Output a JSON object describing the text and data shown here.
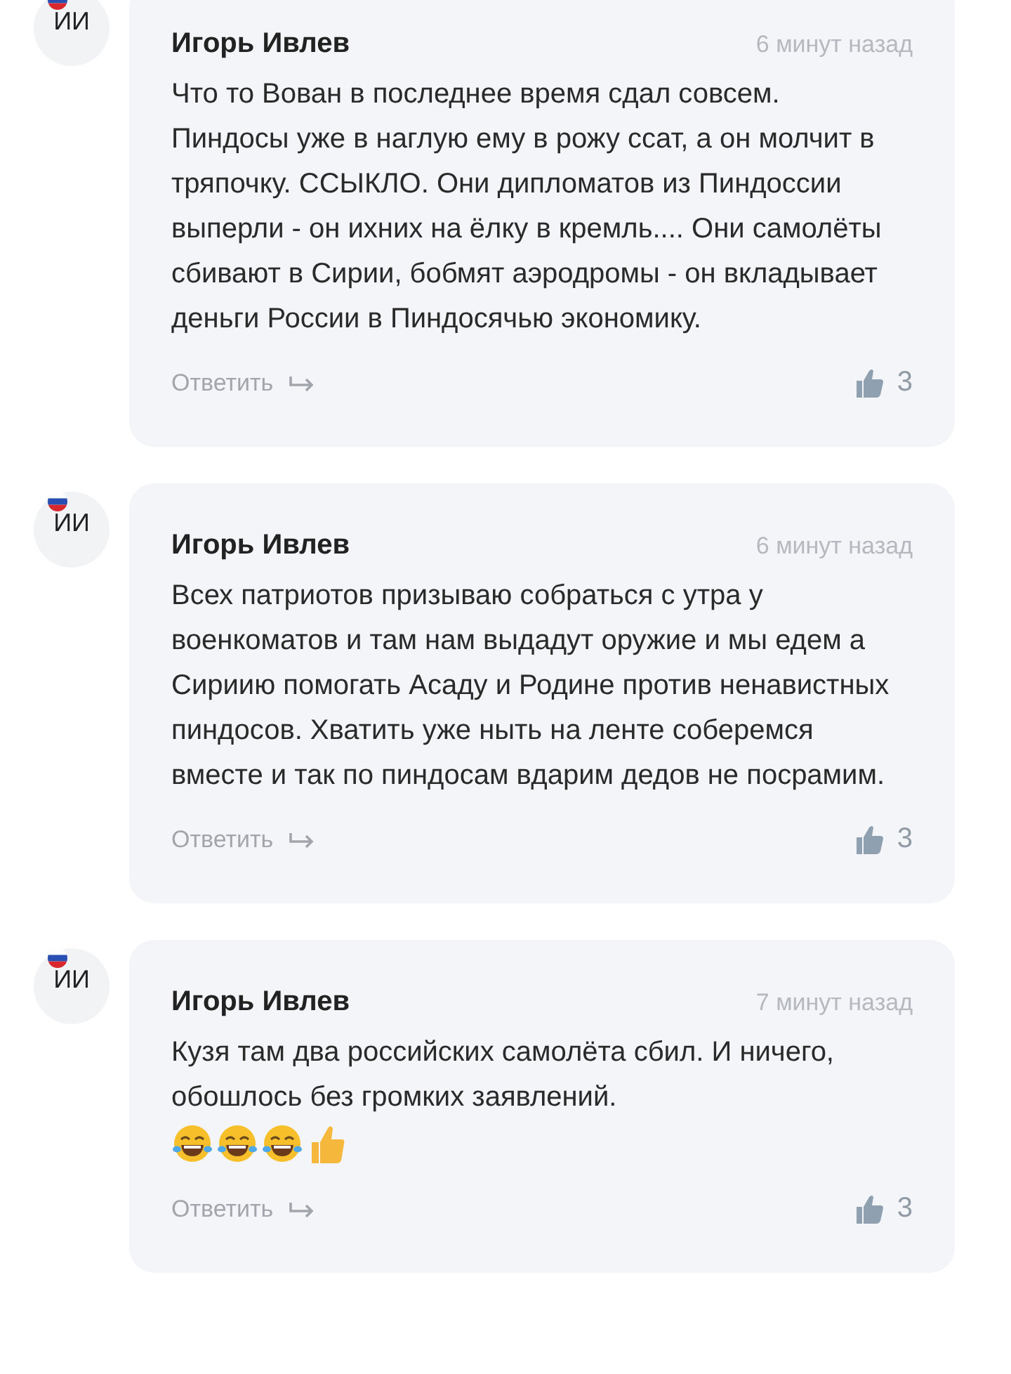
{
  "comments": [
    {
      "avatar": {
        "initials": "ИИ",
        "flag": true
      },
      "author": "Игорь Ивлев",
      "time": "6 минут назад",
      "text": "Что то Вован в последнее время сдал совсем. Пиндосы уже в наглую ему в рожу ссат, а он молчит в тряпочку. ССЫКЛО. Они дипломатов из Пиндоссии выперли - он ихних на ёлку в кремль.... Они самолёты сбивают в Сирии, бобмят аэродромы - он вкладывает деньги России в Пиндосячью экономику.",
      "reply": "Ответить",
      "likes": "3"
    },
    {
      "avatar": {
        "initials": "ИИ",
        "flag": true
      },
      "author": "Игорь Ивлев",
      "time": "6 минут назад",
      "text": "Всех патриотов призываю собраться с утра у военкоматов и там нам выдадут оружие и мы едем а Сириию помогать Асаду и Родине против ненавистных пиндосов. Хватить уже ныть на ленте соберемся вместе и так по пиндосам вдарим дедов не посрамим.",
      "reply": "Ответить",
      "likes": "3"
    },
    {
      "avatar": {
        "initials": "ИИ",
        "flag": true
      },
      "author": "Игорь Ивлев",
      "time": "7 минут назад",
      "text": "Кузя там два российских самолёта сбил. И ничего, обошлось без громких заявлений.",
      "emoji": [
        {
          "kind": "laugh"
        },
        {
          "kind": "laugh"
        },
        {
          "kind": "laugh"
        },
        {
          "kind": "thumbs"
        }
      ],
      "reply": "Ответить",
      "likes": "3"
    }
  ]
}
